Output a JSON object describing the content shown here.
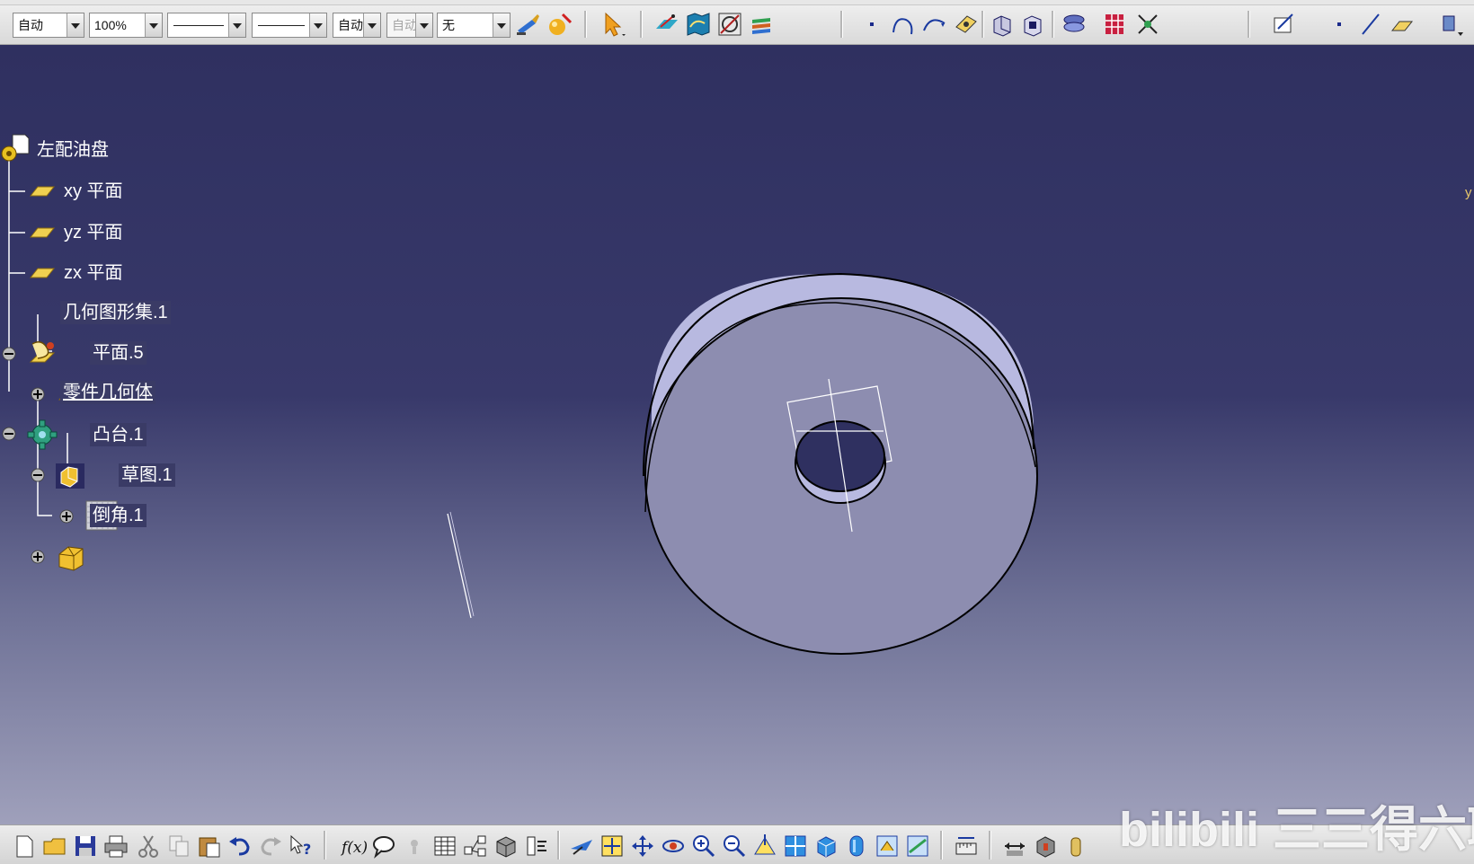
{
  "toolbar": {
    "render_mode": "自动",
    "zoom": "100%",
    "line_color": "自动",
    "line_weight": "自动",
    "layer": "无"
  },
  "tree": {
    "root": "左配油盘",
    "plane_xy": "xy 平面",
    "plane_yz": "yz 平面",
    "plane_zx": "zx 平面",
    "geo_set": "几何图形集.1",
    "plane5": "平面.5",
    "part_body": "零件几何体",
    "pad": "凸台.1",
    "sketch": "草图.1",
    "chamfer": "倒角.1"
  },
  "compass": {
    "axis_label": "y"
  },
  "watermark": {
    "text": "bilibili 三三得六耶"
  },
  "colors": {
    "background_top": "#2f3060",
    "background_bottom": "#9fa0bb",
    "part_face": "#8d8db0",
    "part_side": "#b8b9e0",
    "tree_text": "#ffffff"
  },
  "icons": {
    "top": [
      "paint-brush-icon",
      "material-sphere-icon",
      "select-arrow-icon",
      "sketch-plane-icon",
      "map-icon",
      "sketch-analysis-icon",
      "layers-icon",
      "point-icon",
      "arc-icon",
      "spline-icon",
      "plane-icon",
      "pad-icon",
      "pocket-icon",
      "shaft-icon",
      "pattern-icon",
      "constraint-icon",
      "sketcher-icon",
      "point-icon-2",
      "line-icon",
      "plane-icon-2",
      "more-icon"
    ],
    "bottom": [
      "new-file-icon",
      "open-folder-icon",
      "save-icon",
      "print-icon",
      "cut-icon",
      "copy-icon",
      "paste-icon",
      "undo-icon",
      "redo-icon",
      "help-whats-this-icon",
      "formula-icon",
      "comment-icon",
      "knowledge-icon",
      "table-icon",
      "graph-icon",
      "catalog-icon",
      "scan-icon",
      "fly-mode-icon",
      "fit-all-icon",
      "pan-icon",
      "rotate-icon",
      "zoom-in-icon",
      "zoom-out-icon",
      "normal-view-icon",
      "multi-view-icon",
      "iso-view-icon",
      "render-style-icon",
      "hide-show-icon",
      "swap-view-icon",
      "measure-icon",
      "measure-item-icon",
      "measure-inertia-icon",
      "apply-material-icon",
      "more-icon"
    ]
  }
}
